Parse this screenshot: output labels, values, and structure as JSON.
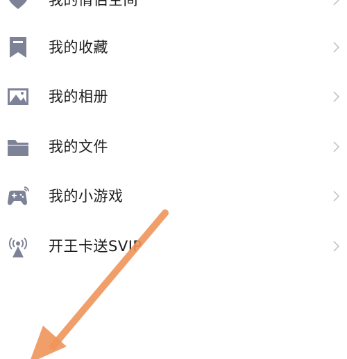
{
  "menu": {
    "items": [
      {
        "label": "我的情侣空间",
        "icon": "heart-icon"
      },
      {
        "label": "我的收藏",
        "icon": "bookmark-icon"
      },
      {
        "label": "我的相册",
        "icon": "photo-icon"
      },
      {
        "label": "我的文件",
        "icon": "folder-icon"
      },
      {
        "label": "我的小游戏",
        "icon": "gamepad-icon"
      },
      {
        "label": "开王卡送SVIP",
        "icon": "broadcast-tower-icon"
      }
    ]
  },
  "colors": {
    "icon": "#7d8296",
    "text": "#1b1b1b",
    "chevron": "#c4c4c4",
    "annotation_arrow": "#f0955a"
  }
}
